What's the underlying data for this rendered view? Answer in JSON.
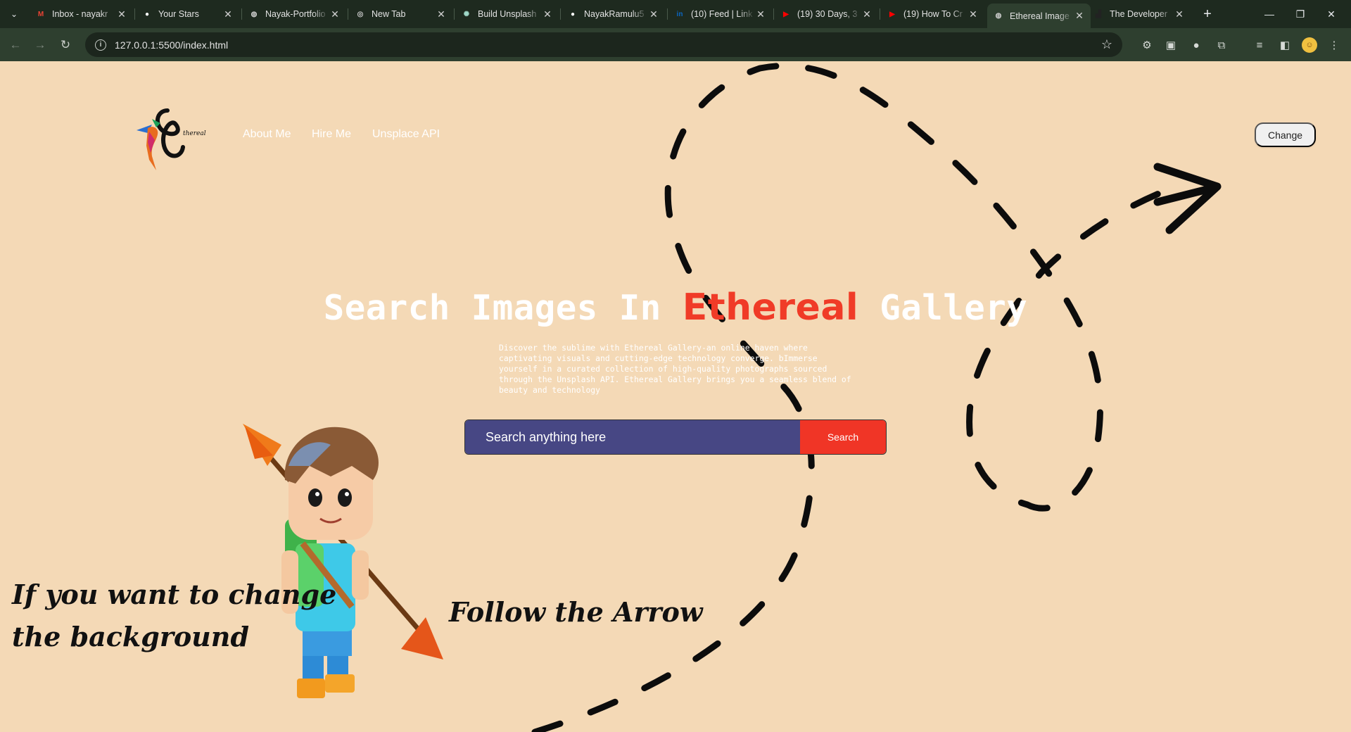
{
  "browser": {
    "tabs": [
      {
        "title": "Inbox - nayakr",
        "icon": "gmail-icon",
        "color": "#ea4335",
        "glyph": "M"
      },
      {
        "title": "Your Stars",
        "icon": "github-icon",
        "color": "#ffffff",
        "glyph": "●"
      },
      {
        "title": "Nayak-Portfolio",
        "icon": "globe-icon",
        "color": "#cfcfcf",
        "glyph": "◍"
      },
      {
        "title": "New Tab",
        "icon": "chrome-icon",
        "color": "#cfcfcf",
        "glyph": "◎"
      },
      {
        "title": "Build Unsplash",
        "icon": "chatgpt-icon",
        "color": "#9fd8c8",
        "glyph": "✺"
      },
      {
        "title": "NayakRamulu5",
        "icon": "github-icon",
        "color": "#ffffff",
        "glyph": "●"
      },
      {
        "title": "(10) Feed | Link",
        "icon": "linkedin-icon",
        "color": "#0a66c2",
        "glyph": "in"
      },
      {
        "title": "(19) 30 Days, 3",
        "icon": "youtube-icon",
        "color": "#ff0000",
        "glyph": "▶"
      },
      {
        "title": "(19) How To Cr",
        "icon": "youtube-icon",
        "color": "#ff0000",
        "glyph": "▶"
      },
      {
        "title": "Ethereal Image",
        "icon": "globe-icon",
        "color": "#cfcfcf",
        "glyph": "◍",
        "active": true
      },
      {
        "title": "The Developer",
        "icon": "dev-icon",
        "color": "#222222",
        "glyph": "▟"
      }
    ],
    "url": "127.0.0.1:5500/index.html"
  },
  "nav": {
    "links": [
      "About Me",
      "Hire Me",
      "Unsplace API"
    ],
    "change_label": "Change",
    "logo_text": "thereal"
  },
  "hero": {
    "title_before": "Search Images In ",
    "title_accent": "Ethereal",
    "title_after": " Gallery",
    "description": "Discover the sublime with Ethereal Gallery-an online haven where captivating visuals and cutting-edge technology converge. bImmerse yourself in a curated collection of high-quality photographs sourced through the Unsplash API. Ethereal Gallery brings you a seamless blend of beauty and technology"
  },
  "search": {
    "placeholder": "Search anything here",
    "button_label": "Search"
  },
  "captions": {
    "left_line1": "If you want to change",
    "left_line2": "the  background",
    "right": "Follow the Arrow"
  },
  "colors": {
    "background": "#f4d9b6",
    "accent": "#f03b27",
    "search_bg": "#474784",
    "chrome_dark": "#1e2a1f"
  }
}
